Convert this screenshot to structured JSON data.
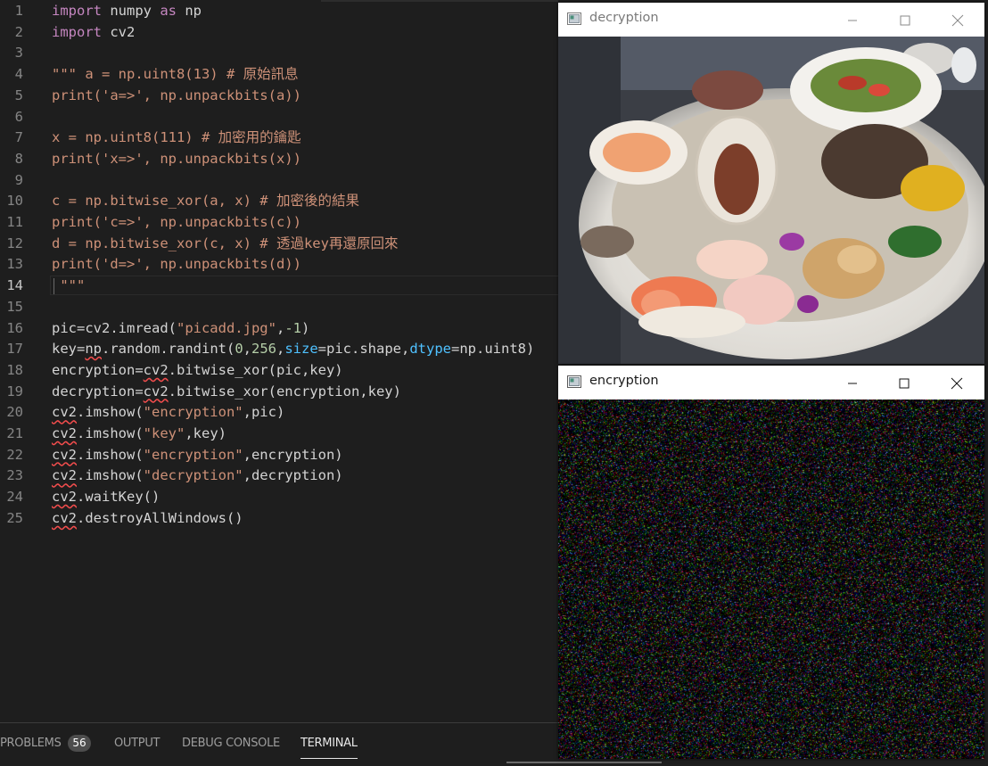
{
  "editor": {
    "active_line": 14,
    "lines": [
      {
        "n": "1",
        "tokens": [
          {
            "t": "import",
            "c": "kw"
          },
          {
            "t": " numpy "
          },
          {
            "t": "as",
            "c": "kw"
          },
          {
            "t": " np"
          }
        ]
      },
      {
        "n": "2",
        "tokens": [
          {
            "t": "import",
            "c": "kw"
          },
          {
            "t": " cv2"
          }
        ]
      },
      {
        "n": "3",
        "tokens": []
      },
      {
        "n": "4",
        "tokens": [
          {
            "t": "\"\"\" a = np.uint8(13) # 原始訊息",
            "c": "str"
          }
        ]
      },
      {
        "n": "5",
        "tokens": [
          {
            "t": "print('a=>', np.unpackbits(a))",
            "c": "str"
          }
        ]
      },
      {
        "n": "6",
        "tokens": []
      },
      {
        "n": "7",
        "tokens": [
          {
            "t": "x = np.uint8(111) # 加密用的鑰匙",
            "c": "str"
          }
        ]
      },
      {
        "n": "8",
        "tokens": [
          {
            "t": "print('x=>', np.unpackbits(x))",
            "c": "str"
          }
        ]
      },
      {
        "n": "9",
        "tokens": []
      },
      {
        "n": "10",
        "tokens": [
          {
            "t": "c = np.bitwise_xor(a, x) # 加密後的結果",
            "c": "str"
          }
        ]
      },
      {
        "n": "11",
        "tokens": [
          {
            "t": "print('c=>', np.unpackbits(c))",
            "c": "str"
          }
        ]
      },
      {
        "n": "12",
        "tokens": [
          {
            "t": "d = np.bitwise_xor(c, x) # 透過key再還原回來",
            "c": "str"
          }
        ]
      },
      {
        "n": "13",
        "tokens": [
          {
            "t": "print('d=>', np.unpackbits(d))",
            "c": "str"
          }
        ]
      },
      {
        "n": "14",
        "tokens": [
          {
            "t": " \"\"\"",
            "c": "str"
          }
        ]
      },
      {
        "n": "15",
        "tokens": []
      },
      {
        "n": "16",
        "tokens": [
          {
            "t": "pic=cv2.imread("
          },
          {
            "t": "\"picadd.jpg\"",
            "c": "str"
          },
          {
            "t": ","
          },
          {
            "t": "-1",
            "c": "num"
          },
          {
            "t": ")"
          }
        ]
      },
      {
        "n": "17",
        "tokens": [
          {
            "t": "key=np.random.randint("
          },
          {
            "t": "0",
            "c": "num"
          },
          {
            "t": ","
          },
          {
            "t": "256",
            "c": "num"
          },
          {
            "t": ","
          },
          {
            "t": "size",
            "c": "prm"
          },
          {
            "t": "=pic.shape,"
          },
          {
            "t": "dtype",
            "c": "prm"
          },
          {
            "t": "=np.uint8)"
          }
        ]
      },
      {
        "n": "18",
        "tokens": [
          {
            "t": "encryption=cv2.bitwise_xor(pic,key)"
          }
        ]
      },
      {
        "n": "19",
        "tokens": [
          {
            "t": "decryption=cv2.bitwise_xor(encryption,key)"
          }
        ]
      },
      {
        "n": "20",
        "tokens": [
          {
            "t": "cv2.imshow("
          },
          {
            "t": "\"encryption\"",
            "c": "str"
          },
          {
            "t": ",pic)"
          }
        ]
      },
      {
        "n": "21",
        "tokens": [
          {
            "t": "cv2.imshow("
          },
          {
            "t": "\"key\"",
            "c": "str"
          },
          {
            "t": ",key)"
          }
        ]
      },
      {
        "n": "22",
        "tokens": [
          {
            "t": "cv2.imshow("
          },
          {
            "t": "\"encryption\"",
            "c": "str"
          },
          {
            "t": ",encryption)"
          }
        ]
      },
      {
        "n": "23",
        "tokens": [
          {
            "t": "cv2.imshow("
          },
          {
            "t": "\"decryption\"",
            "c": "str"
          },
          {
            "t": ",decryption)"
          }
        ]
      },
      {
        "n": "24",
        "tokens": [
          {
            "t": "cv2.waitKey()"
          }
        ]
      },
      {
        "n": "25",
        "tokens": [
          {
            "t": "cv2.destroyAllWindows()"
          }
        ]
      }
    ]
  },
  "panel": {
    "problems_label": "PROBLEMS",
    "problems_count": "56",
    "output_label": "OUTPUT",
    "debug_label": "DEBUG CONSOLE",
    "terminal_label": "TERMINAL",
    "active_tab": "TERMINAL"
  },
  "windows": {
    "decryption_title": "decryption",
    "encryption_title": "encryption"
  },
  "colors": {
    "editor_bg": "#1e1e1e",
    "keyword": "#c586c0",
    "string": "#ce9178",
    "number": "#b5cea8",
    "parameter": "#4fc1ff",
    "default_text": "#d4d4d4",
    "error_squiggle": "#f14c4c"
  },
  "icons": {
    "window_app": "opencv-window-icon",
    "minimize": "minimize-icon",
    "maximize": "maximize-icon",
    "close": "close-icon"
  }
}
